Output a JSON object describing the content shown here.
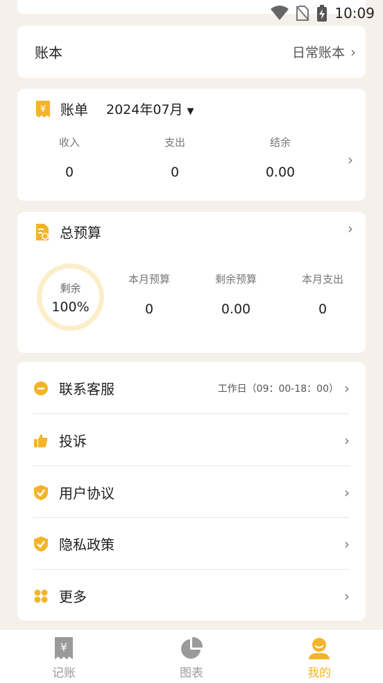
{
  "status_bar": {
    "time": "10:09"
  },
  "ledger": {
    "label": "账本",
    "value": "日常账本"
  },
  "bill": {
    "title": "账单",
    "month": "2024年07月",
    "stats": [
      {
        "label": "收入",
        "value": "0"
      },
      {
        "label": "支出",
        "value": "0"
      },
      {
        "label": "结余",
        "value": "0.00"
      }
    ]
  },
  "budget": {
    "title": "总预算",
    "ring": {
      "label": "剩余",
      "value": "100%"
    },
    "stats": [
      {
        "label": "本月预算",
        "value": "0"
      },
      {
        "label": "剩余预算",
        "value": "0.00"
      },
      {
        "label": "本月支出",
        "value": "0"
      }
    ]
  },
  "menu": {
    "items": [
      {
        "label": "联系客服",
        "sub": "工作日（09：00-18：00）",
        "icon": "chat-icon"
      },
      {
        "label": "投诉",
        "icon": "thumbs-up-icon"
      },
      {
        "label": "用户协议",
        "icon": "shield-check-icon"
      },
      {
        "label": "隐私政策",
        "icon": "shield-check-icon"
      },
      {
        "label": "更多",
        "icon": "grid-icon"
      }
    ]
  },
  "nav": {
    "items": [
      {
        "label": "记账",
        "icon": "receipt-yen-icon",
        "active": false
      },
      {
        "label": "图表",
        "icon": "pie-chart-icon",
        "active": false
      },
      {
        "label": "我的",
        "icon": "user-icon",
        "active": true
      }
    ]
  },
  "colors": {
    "accent": "#f4b42a",
    "background": "#f5f1ea",
    "ring": "#fbeec9"
  }
}
